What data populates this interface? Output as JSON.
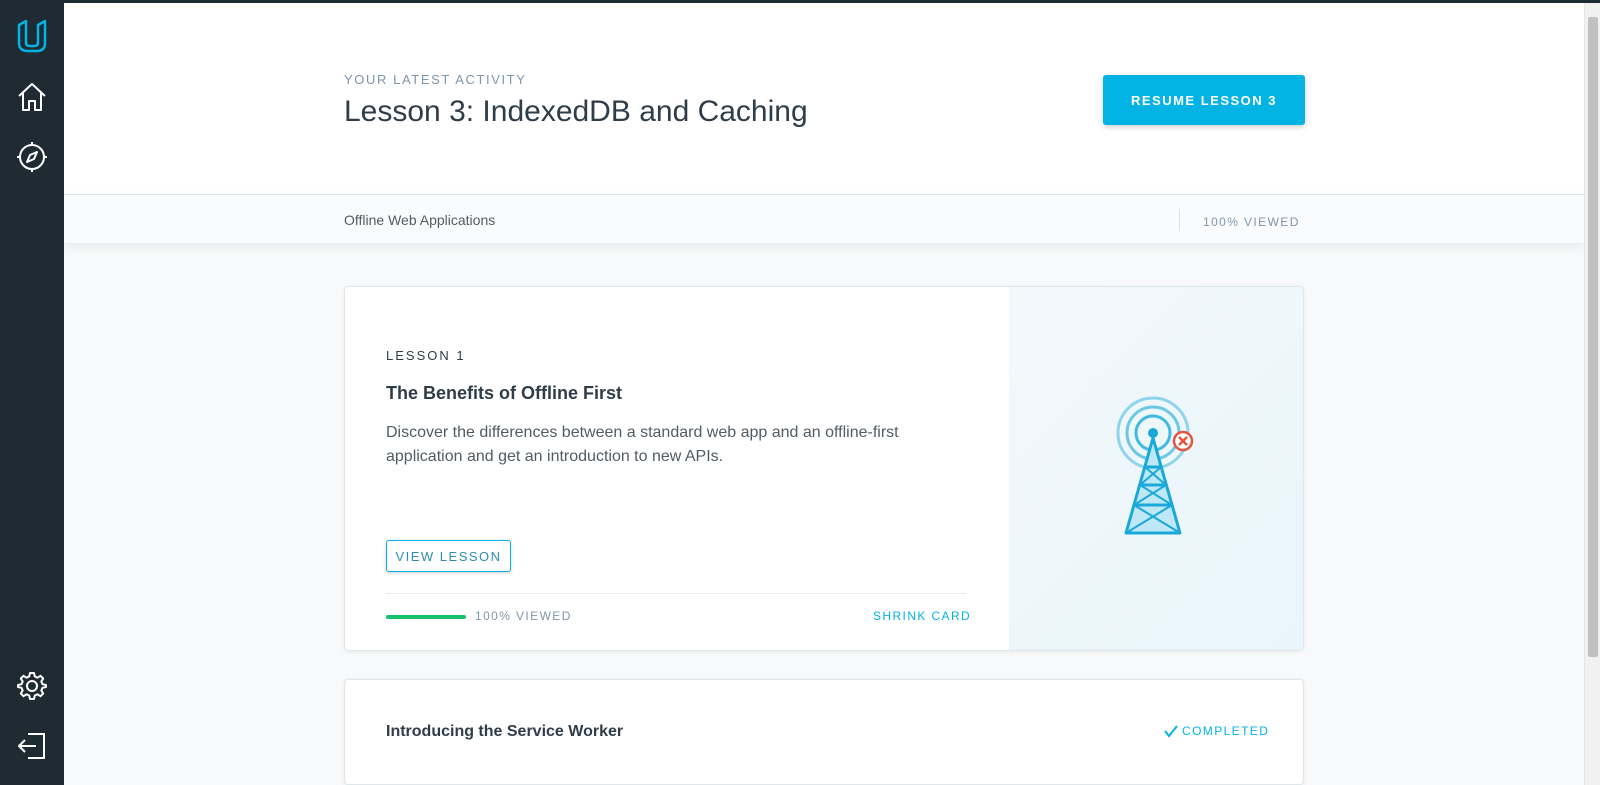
{
  "header": {
    "eyebrow": "YOUR LATEST ACTIVITY",
    "title": "Lesson 3: IndexedDB and Caching",
    "resume_label": "RESUME LESSON 3"
  },
  "subbar": {
    "course": "Offline Web Applications",
    "viewed": "100% VIEWED"
  },
  "lesson_card": {
    "number": "LESSON 1",
    "title": "The Benefits of Offline First",
    "description": "Discover the differences between a standard web app and an offline-first application and get an introduction to new APIs.",
    "view_label": "VIEW LESSON",
    "progress_fraction": 1.0,
    "progress_label": "100% VIEWED",
    "shrink_label": "SHRINK CARD"
  },
  "next_card": {
    "title": "Introducing the Service Worker",
    "status": "COMPLETED"
  },
  "sidebar": {
    "icons": [
      "udacity-logo-icon",
      "home-icon",
      "compass-icon",
      "gear-icon",
      "logout-icon"
    ]
  },
  "colors": {
    "sidebar_bg": "#1f2b33",
    "accent": "#02b3e4",
    "progress": "#15c26b"
  }
}
